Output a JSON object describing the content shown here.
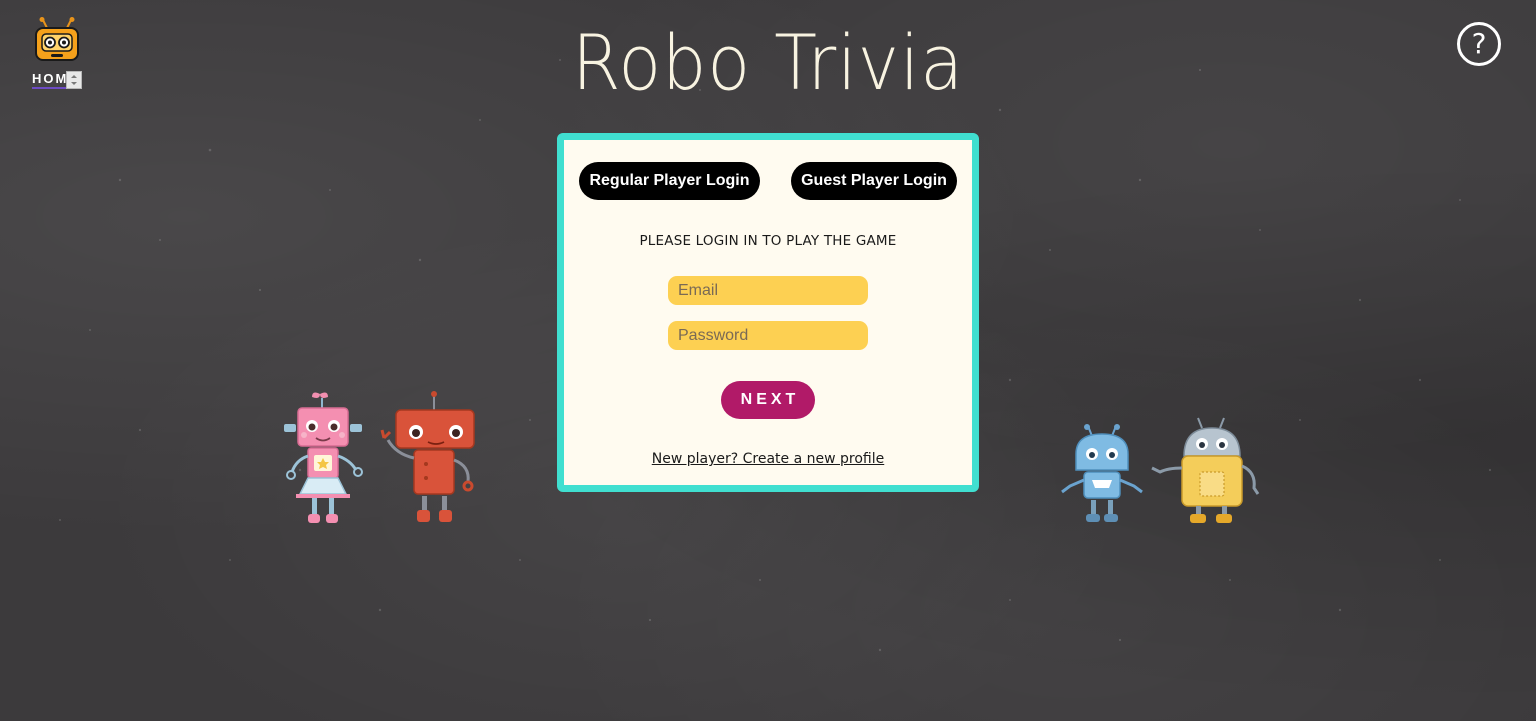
{
  "header": {
    "home_label": "HOME",
    "title": "Robo Trivia",
    "help_symbol": "?",
    "home_icon": "robot-head-icon",
    "help_icon": "question-circle-icon"
  },
  "login": {
    "tabs": [
      {
        "label": "Regular Player Login"
      },
      {
        "label": "Guest Player Login"
      }
    ],
    "prompt": "PLEASE LOGIN IN TO PLAY THE GAME",
    "email_placeholder": "Email",
    "email_value": "",
    "password_placeholder": "Password",
    "password_value": "",
    "next_label": "NEXT",
    "signup_link": "New player? Create a new profile"
  },
  "colors": {
    "background": "#3c3a3c",
    "card": "#fffbf0",
    "card_border": "#40dfd0",
    "input": "#fdd052",
    "next_button": "#b11a68",
    "tab_button": "#000000",
    "title": "#f8f3e1"
  },
  "decorations": {
    "robots": [
      "pink-robot-icon",
      "red-robot-icon",
      "blue-robot-icon",
      "yellow-robot-icon"
    ]
  }
}
